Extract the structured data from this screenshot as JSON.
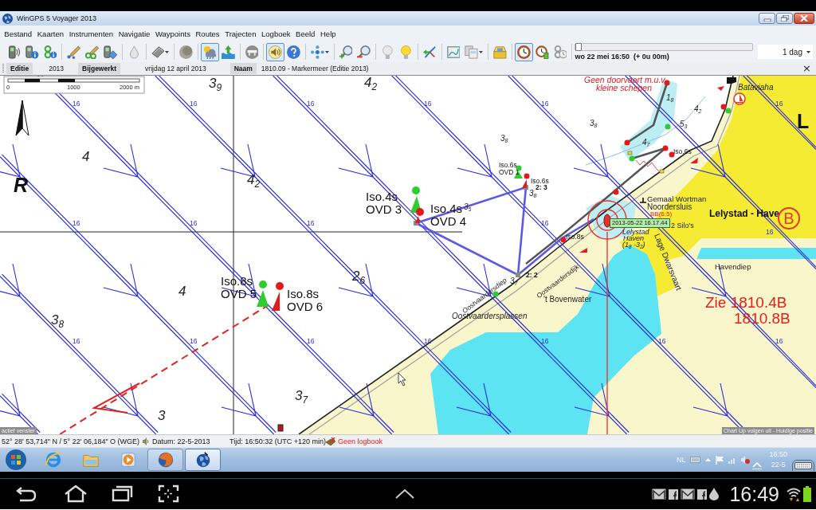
{
  "window": {
    "title": "WinGPS 5 Voyager 2013"
  },
  "menu": [
    "Bestand",
    "Kaarten",
    "Instrumenten",
    "Navigatie",
    "Waypoints",
    "Routes",
    "Trajecten",
    "Logboek",
    "Beeld",
    "Help"
  ],
  "toolbar": {
    "buttons": [
      {
        "selected": false
      },
      {
        "selected": false
      },
      {
        "selected": false
      },
      {
        "selected": false
      },
      {
        "selected": false
      },
      {
        "selected": false
      },
      {
        "selected": false
      },
      {
        "selected": false
      },
      {
        "selected": false
      },
      {
        "selected": true
      },
      {
        "selected": false
      },
      {
        "selected": false
      },
      {
        "selected": true
      },
      {
        "selected": false
      },
      {
        "selected": false
      },
      {
        "selected": false
      },
      {
        "selected": false
      },
      {
        "selected": false
      },
      {
        "selected": false
      },
      {
        "selected": false
      },
      {
        "selected": false
      },
      {
        "selected": false
      },
      {
        "selected": false
      },
      {
        "selected": true
      },
      {
        "selected": false
      },
      {
        "selected": false
      }
    ]
  },
  "timeline": {
    "level": 0,
    "label": "wo 22 mei 16:50  (+ 0u 00m)"
  },
  "period": {
    "value": "1 dag"
  },
  "info_bar": {
    "fields": [
      {
        "label": "Editie",
        "value": "2013"
      },
      {
        "label": "Bijgewerkt",
        "value": "vrijdag 12 april 2013"
      },
      {
        "label": "Naam",
        "value": "1810.09 - Markermeer (Editie 2013)"
      }
    ],
    "close": "×"
  },
  "chart": {
    "scale": [
      "0",
      "1000",
      "2000 m"
    ],
    "area_letters": [
      "R",
      "L"
    ],
    "depths": [
      {
        "kind": "large",
        "text": "3$_{9}$"
      },
      {
        "kind": "large",
        "text": "4$_{2}$"
      },
      {
        "kind": "large",
        "text": "4"
      },
      {
        "kind": "large",
        "text": "4$_{2}$"
      },
      {
        "kind": "large",
        "text": "4"
      },
      {
        "kind": "large",
        "text": "3$_{8}$"
      },
      {
        "kind": "large",
        "text": "2$_{6}$"
      },
      {
        "kind": "large",
        "text": "3$_{7}$"
      },
      {
        "kind": "large",
        "text": "3"
      },
      {
        "kind": "small",
        "text": "3$_{8}$"
      },
      {
        "kind": "small",
        "text": "3$_{8}$"
      },
      {
        "kind": "small",
        "text": "4$_{2}$"
      },
      {
        "kind": "small",
        "text": "5$_{3}$"
      },
      {
        "kind": "small",
        "text": "4$_{7}$"
      },
      {
        "kind": "small",
        "text": "3$_{5}$"
      },
      {
        "kind": "small",
        "text": "3$_{7}$"
      },
      {
        "kind": "small",
        "text": "1$_{8}$"
      },
      {
        "kind": "small",
        "text": "3$_{8}$"
      }
    ],
    "current_rates": [
      "16",
      "16",
      "16",
      "16",
      "16",
      "16",
      "16",
      "16",
      "16",
      "16",
      "16",
      "16",
      "16",
      "16",
      "16",
      "16",
      "16",
      "16"
    ],
    "lights": [
      {
        "kind": "major",
        "character": "Iso.4s",
        "name": "OVD 3"
      },
      {
        "kind": "major",
        "character": "Iso.4s",
        "name": "OVD 4"
      },
      {
        "kind": "major",
        "character": "Iso.8s",
        "name": "OVD 5"
      },
      {
        "kind": "major",
        "character": "Iso.8s",
        "name": "OVD 6"
      },
      {
        "kind": "minor",
        "character": "Iso.6s",
        "name": "OVD 1"
      },
      {
        "kind": "minor",
        "character": "Iso.6s"
      },
      {
        "kind": "minor",
        "character": "Iso.6s"
      },
      {
        "kind": "minor",
        "character": "Iso.8s"
      }
    ],
    "route_labels": [
      "2: 3",
      "2: 2"
    ],
    "places": [
      {
        "kind": "warning",
        "text": "Geen doorvaart m.u.v."
      },
      {
        "kind": "warning",
        "text": "kleine schepen"
      },
      {
        "kind": "water",
        "text": "Bataviaha"
      },
      {
        "kind": "land",
        "text": "Gemaal Wortman"
      },
      {
        "kind": "land",
        "text": "Noordersluis"
      },
      {
        "kind": "signal",
        "text": "BB(6.5)"
      },
      {
        "kind": "land",
        "text": "2 Silo's"
      },
      {
        "kind": "water",
        "text": "Lelystad"
      },
      {
        "kind": "water",
        "text": "Haven"
      },
      {
        "kind": "water",
        "text": "(1$_{8}$ -3$_{2}$)"
      },
      {
        "kind": "town",
        "text": "Lelystad - Have"
      },
      {
        "kind": "land",
        "text": "Havendiep"
      },
      {
        "kind": "land",
        "text": "Lage Dwarsvaart"
      },
      {
        "kind": "water",
        "text": "Oostvaardersdiep"
      },
      {
        "kind": "land",
        "text": "Oostvaardersdijk"
      },
      {
        "kind": "land",
        "text": "'t Bovenwater"
      },
      {
        "kind": "water",
        "text": "Oostvaardersplassen"
      },
      {
        "kind": "reference",
        "text": "Zie 1810.4B"
      },
      {
        "kind": "reference",
        "text": "1810.8B"
      }
    ],
    "harbour_marker": "B",
    "track_time": "2013-05-22 16.17.44",
    "buoys": [
      {
        "kind": "buoy",
        "color": "#2ecc2e"
      },
      {
        "kind": "buoy",
        "color": "#e01b1b"
      },
      {
        "kind": "buoy",
        "color": "#2ecc2e"
      },
      {
        "kind": "buoy",
        "color": "#e01b1b"
      },
      {
        "kind": "buoy",
        "color": "#2ecc2e"
      },
      {
        "kind": "buoy",
        "color": "#e01b1b"
      },
      {
        "kind": "beacon",
        "color": "#e01b1b"
      },
      {
        "kind": "beacon",
        "color": "#2ecc2e"
      },
      {
        "kind": "beacon",
        "color": "#e01b1b"
      },
      {
        "kind": "beacon",
        "color": "#e01b1b"
      },
      {
        "kind": "beacon",
        "color": "#2ecc2e"
      },
      {
        "kind": "beacon",
        "color": "#e01b1b"
      },
      {
        "kind": "beacon",
        "color": "#e01b1b"
      },
      {
        "kind": "beacon",
        "color": "#2ecc2e"
      },
      {
        "kind": "beacon",
        "color": "#e01b1b"
      },
      {
        "kind": "beacon",
        "color": "#e01b1b"
      },
      {
        "kind": "beacon",
        "color": "#2ecc2e"
      }
    ],
    "window_label": "actief venster",
    "mode_label": "Chart Up volgen uit - Huidige positie"
  },
  "status_bar": {
    "position": "52° 28' 53,714\" N / 5° 22' 06,184\" O (WGE)",
    "date": "Datum: 22-5-2013",
    "time": "Tijd: 16:50:32 (UTC +120 min)",
    "logbook": "Geen logbook"
  },
  "taskbar": {
    "apps": [
      {
        "running": false,
        "selected": false
      },
      {
        "running": false,
        "selected": false
      },
      {
        "running": false,
        "selected": false
      },
      {
        "running": true,
        "selected": false
      },
      {
        "running": true,
        "selected": true
      }
    ],
    "tray": {
      "language": "NL",
      "time": "16:50",
      "date": "22-5"
    }
  },
  "android": {
    "clock": "16:49"
  }
}
